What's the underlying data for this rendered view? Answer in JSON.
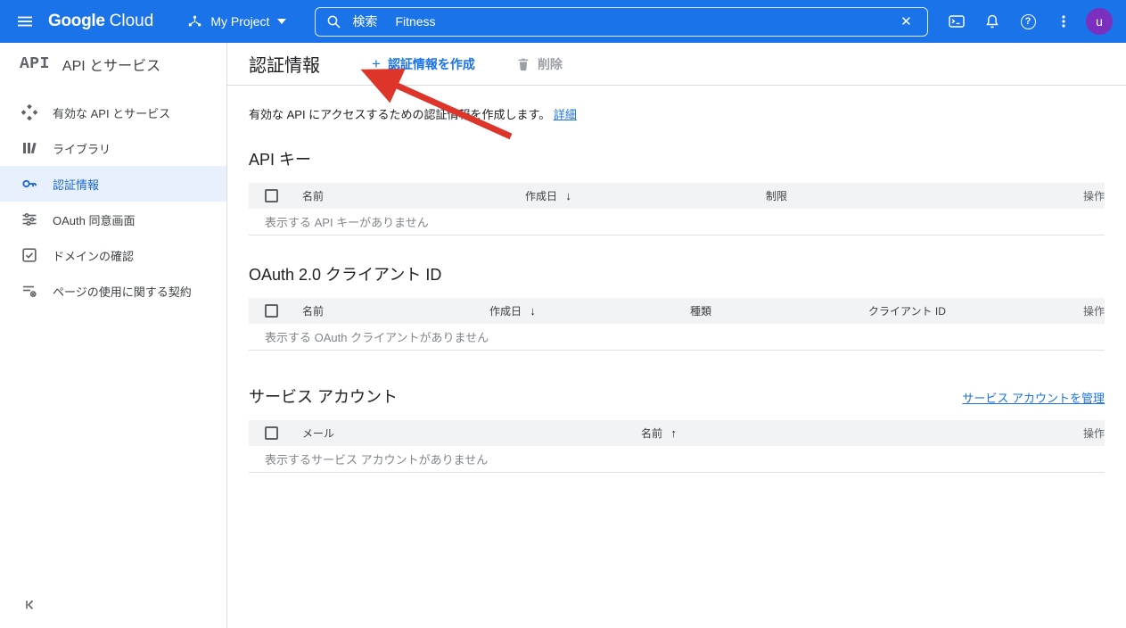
{
  "topbar": {
    "logo": {
      "google": "Google",
      "cloud": "Cloud"
    },
    "project": {
      "label": "My Project"
    },
    "search": {
      "label": "検索",
      "value": "Fitness"
    },
    "avatar": {
      "letter": "u"
    }
  },
  "sidebar": {
    "logo": "API",
    "title": "API とサービス",
    "items": [
      {
        "label": "有効な API とサービス",
        "icon": "enabled-apis-icon",
        "selected": false
      },
      {
        "label": "ライブラリ",
        "icon": "library-icon",
        "selected": false
      },
      {
        "label": "認証情報",
        "icon": "key-icon",
        "selected": true
      },
      {
        "label": "OAuth 同意画面",
        "icon": "oauth-consent-icon",
        "selected": false
      },
      {
        "label": "ドメインの確認",
        "icon": "domain-verification-icon",
        "selected": false
      },
      {
        "label": "ページの使用に関する契約",
        "icon": "page-usage-agreements-icon",
        "selected": false
      }
    ]
  },
  "header": {
    "title": "認証情報",
    "create_button": "認証情報を作成",
    "delete_button": "削除"
  },
  "intro": {
    "text": "有効な API にアクセスするための認証情報を作成します。",
    "link": "詳細"
  },
  "sections": {
    "api_keys": {
      "title": "API キー",
      "columns": [
        "名前",
        "作成日",
        "制限",
        "操作"
      ],
      "sort": {
        "column": "作成日",
        "direction": "desc"
      },
      "empty": "表示する API キーがありません"
    },
    "oauth_clients": {
      "title": "OAuth 2.0 クライアント ID",
      "columns": [
        "名前",
        "作成日",
        "種類",
        "クライアント ID",
        "操作"
      ],
      "sort": {
        "column": "作成日",
        "direction": "desc"
      },
      "empty": "表示する OAuth クライアントがありません"
    },
    "service_accounts": {
      "title": "サービス アカウント",
      "manage_link": "サービス アカウントを管理",
      "columns": [
        "メール",
        "名前",
        "操作"
      ],
      "sort": {
        "column": "名前",
        "direction": "asc"
      },
      "empty": "表示するサービス アカウントがありません"
    }
  },
  "icons": {
    "sort_desc": "↓",
    "sort_asc": "↑",
    "plus": "+",
    "help": "?",
    "close": "✕"
  },
  "colors": {
    "topbar": "#1a73e8",
    "accent": "#1a73e8",
    "selected_bg": "#e8f0fe",
    "selected_text": "#1967d2",
    "table_header_bg": "#f1f3f4",
    "muted_text": "#80868b",
    "annotation_arrow": "#dd352a"
  }
}
